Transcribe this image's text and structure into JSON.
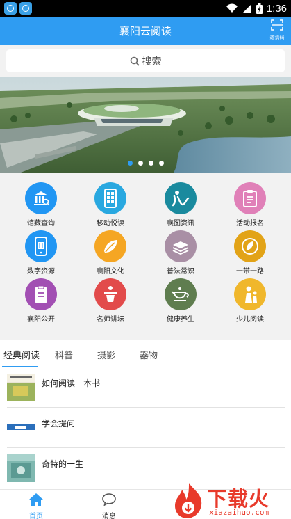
{
  "status_bar": {
    "time": "1:36"
  },
  "header": {
    "title": "襄阳云阅读",
    "scan_label": "邀请码"
  },
  "search": {
    "placeholder": "搜索"
  },
  "banner": {
    "slide_count": 4,
    "active_slide": 1
  },
  "grid": {
    "items": [
      {
        "label": "馆藏查询",
        "icon": "library-building-icon",
        "color": "#2196f3"
      },
      {
        "label": "移动悦读",
        "icon": "mobile-reader-icon",
        "color": "#29a8e0"
      },
      {
        "label": "襄图资讯",
        "icon": "news-icon",
        "color": "#1a8a9e"
      },
      {
        "label": "活动报名",
        "icon": "clipboard-icon",
        "color": "#e080b8"
      },
      {
        "label": "数字资源",
        "icon": "phone-resource-icon",
        "color": "#2196f3"
      },
      {
        "label": "襄阳文化",
        "icon": "culture-leaf-icon",
        "color": "#f5a623"
      },
      {
        "label": "普法常识",
        "icon": "book-stack-icon",
        "color": "#a98fa5"
      },
      {
        "label": "一带一路",
        "icon": "belt-road-icon",
        "color": "#e2a317"
      },
      {
        "label": "襄阳公开",
        "icon": "notice-icon",
        "color": "#a24fb3"
      },
      {
        "label": "名师讲坛",
        "icon": "lectern-icon",
        "color": "#e24b4b"
      },
      {
        "label": "健康养生",
        "icon": "teapot-icon",
        "color": "#5f7d4f"
      },
      {
        "label": "少儿阅读",
        "icon": "children-icon",
        "color": "#f0b72c"
      }
    ]
  },
  "tabs": {
    "items": [
      {
        "label": "经典阅读",
        "active": true
      },
      {
        "label": "科普",
        "active": false
      },
      {
        "label": "摄影",
        "active": false
      },
      {
        "label": "器物",
        "active": false
      }
    ]
  },
  "list": {
    "items": [
      {
        "title": "如何阅读一本书",
        "thumb_text": "如何阅读一本书"
      },
      {
        "title": "学会提问"
      },
      {
        "title": "奇特的一生"
      }
    ]
  },
  "bottom_nav": {
    "items": [
      {
        "label": "首页",
        "icon": "home-icon",
        "active": true
      },
      {
        "label": "消息",
        "icon": "message-icon",
        "active": false
      }
    ]
  },
  "watermark": {
    "text": "下载火",
    "sub": "xiazaihuo.com"
  },
  "colors": {
    "accent": "#2f9cf2",
    "watermark": "#e83a2b"
  }
}
